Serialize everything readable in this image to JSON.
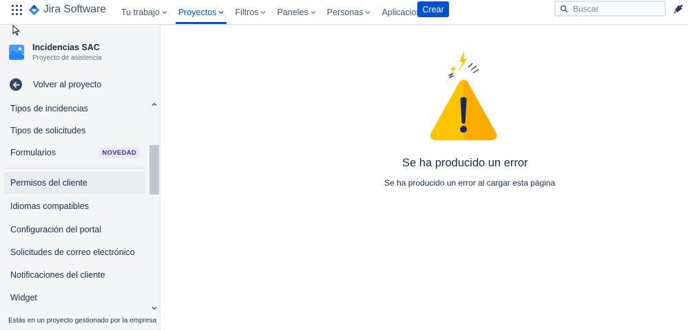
{
  "header": {
    "app_name": "Jira Software",
    "nav": [
      {
        "label": "Tu trabajo"
      },
      {
        "label": "Proyectos"
      },
      {
        "label": "Filtros"
      },
      {
        "label": "Paneles"
      },
      {
        "label": "Personas"
      },
      {
        "label": "Aplicaciones"
      }
    ],
    "active_nav": "Proyectos",
    "create_label": "Crear",
    "search_placeholder": "Buscar",
    "icons": [
      "app-switcher-icon",
      "jira-logo-icon",
      "chevron-down-icon",
      "search-icon",
      "notifications-icon"
    ]
  },
  "sidebar": {
    "project_name": "Incidencias SAC",
    "project_type": "Proyecto de asistencia",
    "back_label": "Volver al proyecto",
    "items": [
      {
        "label": "Tipos de incidencias"
      },
      {
        "label": "Tipos de solicitudes"
      },
      {
        "label": "Formularios",
        "badge": "NOVEDAD"
      },
      {
        "label": "Permisos del cliente"
      },
      {
        "label": "Idiomas compatibles"
      },
      {
        "label": "Configuración del portal"
      },
      {
        "label": "Solicitudes de correo electrónico"
      },
      {
        "label": "Notificaciones del cliente"
      },
      {
        "label": "Widget"
      }
    ],
    "selected_item": "Permisos del cliente",
    "footer": "Estás en un proyecto gestionado por la empresa"
  },
  "main": {
    "error_title": "Se ha producido un error",
    "error_message": "Se ha producido un error al cargar esta página"
  },
  "colors": {
    "primary": "#0052cc",
    "text": "#172b4d",
    "sidebar_bg": "#f4f5f7",
    "warning": "#ffc400"
  }
}
